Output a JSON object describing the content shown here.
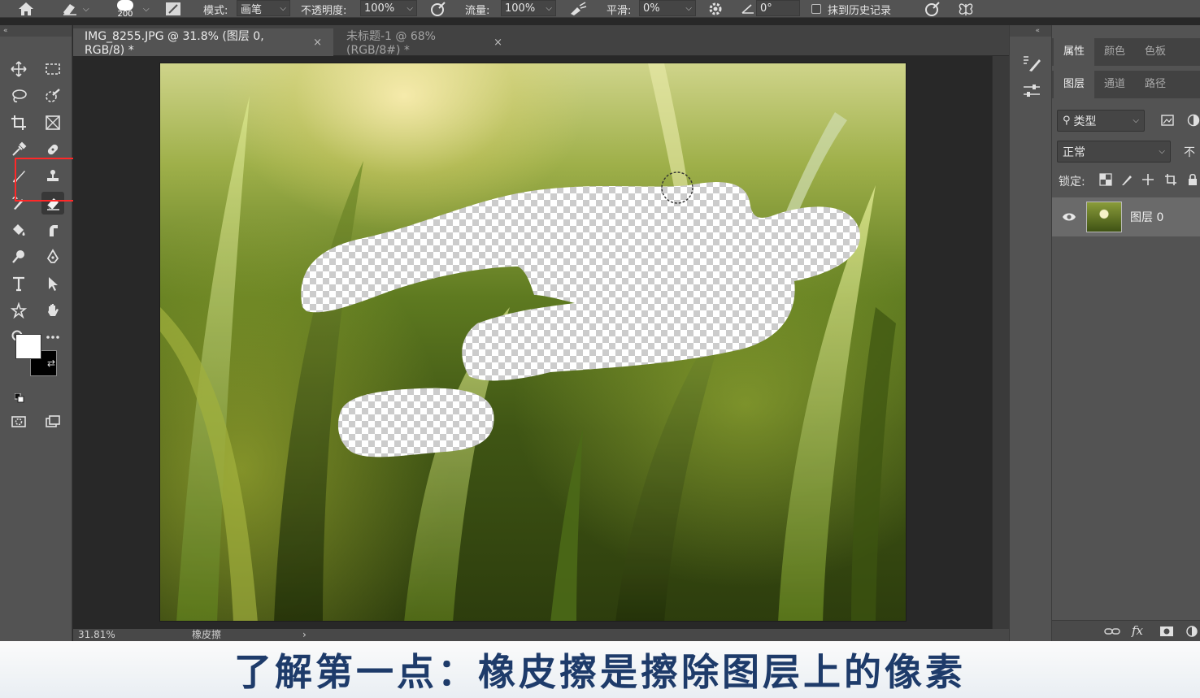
{
  "options_bar": {
    "brush_size": "200",
    "mode_label": "模式:",
    "mode_value": "画笔",
    "opacity_label": "不透明度:",
    "opacity_value": "100%",
    "flow_label": "流量:",
    "flow_value": "100%",
    "smoothing_label": "平滑:",
    "smoothing_value": "0%",
    "angle_value": "0°",
    "erase_history_label": "抹到历史记录"
  },
  "document_tabs": [
    {
      "label": "IMG_8255.JPG @ 31.8% (图层 0, RGB/8) *",
      "close": "×"
    },
    {
      "label": "未标题-1 @ 68%(RGB/8#) *",
      "close": "×"
    }
  ],
  "status_bar": {
    "zoom": "31.81%",
    "tool_name": "橡皮擦",
    "arrow": "›"
  },
  "colors": {
    "foreground": "#ffffff",
    "background": "#000000",
    "highlight": "#ff2828",
    "subtitle_text": "#1e3b6a"
  },
  "right_panel": {
    "top_tabs": [
      "属性",
      "颜色",
      "色板"
    ],
    "layer_tabs": [
      "图层",
      "通道",
      "路径"
    ],
    "filter_label": "类型",
    "blend_mode": "正常",
    "opacity_partial": "不",
    "lock_label": "锁定:",
    "layer_name": "图层 0",
    "footer_fx": "fx"
  },
  "tools": [
    "move-tool",
    "marquee-tool",
    "lasso-tool",
    "quick-select-tool",
    "crop-tool",
    "frame-tool",
    "eyedropper-tool",
    "healing-tool",
    "brush-tool",
    "clone-stamp-tool",
    "history-brush-tool",
    "eraser-tool",
    "paint-bucket-tool",
    "smudge-tool",
    "dodge-tool",
    "pen-tool",
    "type-tool",
    "path-select-tool",
    "shape-tool",
    "hand-tool",
    "zoom-tool",
    "more-tools"
  ],
  "subtitle": "了解第一点：橡皮擦是擦除图层上的像素"
}
